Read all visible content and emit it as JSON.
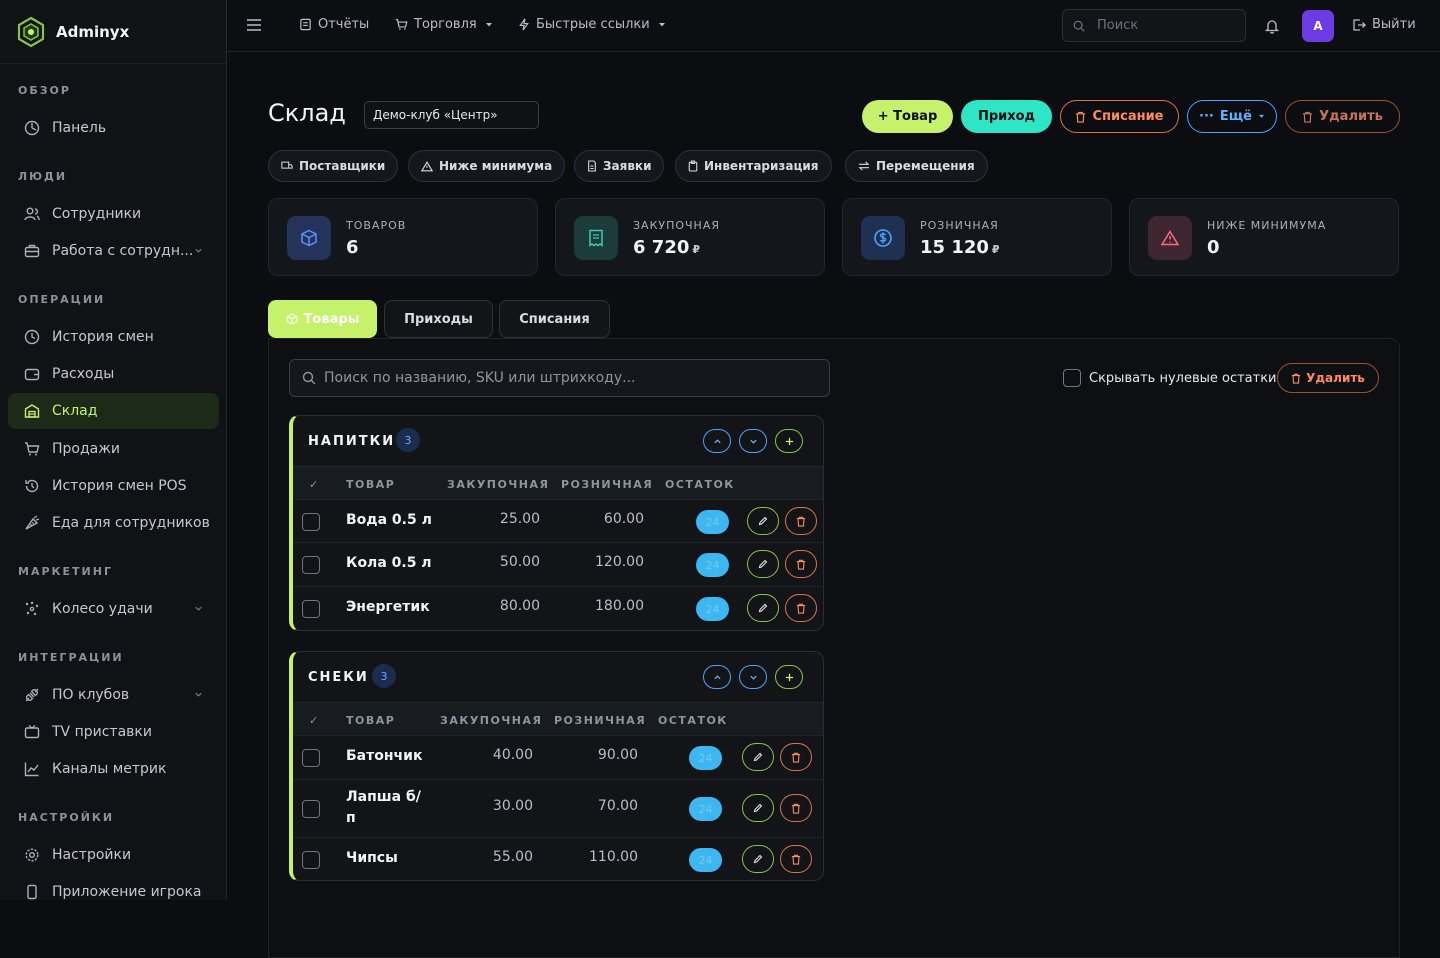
{
  "brand": {
    "name": "Adminyx"
  },
  "sidebar": {
    "sections": [
      {
        "title": "ОБЗОР",
        "items": [
          {
            "label": "Панель",
            "icon": "dashboard-icon"
          }
        ]
      },
      {
        "title": "ЛЮДИ",
        "items": [
          {
            "label": "Сотрудники",
            "icon": "users-icon"
          },
          {
            "label": "Работа с сотрудн...",
            "icon": "briefcase-icon",
            "expandable": true
          }
        ]
      },
      {
        "title": "ОПЕРАЦИИ",
        "items": [
          {
            "label": "История смен",
            "icon": "clock-icon"
          },
          {
            "label": "Расходы",
            "icon": "wallet-icon"
          },
          {
            "label": "Склад",
            "icon": "warehouse-icon",
            "active": true
          },
          {
            "label": "Продажи",
            "icon": "cart-icon"
          },
          {
            "label": "История смен POS",
            "icon": "history-icon"
          },
          {
            "label": "Еда для сотрудников",
            "icon": "food-icon"
          }
        ]
      },
      {
        "title": "МАРКЕТИНГ",
        "items": [
          {
            "label": "Колесо удачи",
            "icon": "wheel-icon",
            "expandable": true
          }
        ]
      },
      {
        "title": "ИНТЕГРАЦИИ",
        "items": [
          {
            "label": "ПО клубов",
            "icon": "plug-icon",
            "expandable": true
          },
          {
            "label": "TV приставки",
            "icon": "tv-icon"
          },
          {
            "label": "Каналы метрик",
            "icon": "chart-icon"
          }
        ]
      },
      {
        "title": "НАСТРОЙКИ",
        "items": [
          {
            "label": "Настройки",
            "icon": "gear-icon"
          },
          {
            "label": "Приложение игрока",
            "icon": "phone-icon"
          }
        ]
      }
    ]
  },
  "topbar": {
    "reports": "Отчёты",
    "trade": "Торговля",
    "quick_links": "Быстрые ссылки",
    "search_placeholder": "Поиск",
    "avatar_letter": "A",
    "logout": "Выйти"
  },
  "page": {
    "title": "Склад",
    "club": "Демо-клуб «Центр»",
    "actions": {
      "add_product": "+ Товар",
      "income": "Приход",
      "writeoff": "Списание",
      "more": "Ещё",
      "delete": "Удалить"
    },
    "chips": [
      "Поставщики",
      "Ниже минимума",
      "Заявки",
      "Инвентаризация",
      "Перемещения"
    ]
  },
  "stats": [
    {
      "label": "ТОВАРОВ",
      "value": "6",
      "currency": "",
      "color": "#5b8dff",
      "icon": "box-icon"
    },
    {
      "label": "ЗАКУПОЧНАЯ",
      "value": "6 720",
      "currency": "₽",
      "color": "#3fc9b0",
      "icon": "receipt-icon"
    },
    {
      "label": "РОЗНИЧНАЯ",
      "value": "15 120",
      "currency": "₽",
      "color": "#4aa3ff",
      "icon": "dollar-icon"
    },
    {
      "label": "НИЖЕ МИНИМУМА",
      "value": "0",
      "currency": "",
      "color": "#ff6b7a",
      "icon": "alert-icon"
    }
  ],
  "tabs": [
    "Товары",
    "Приходы",
    "Списания"
  ],
  "inventory": {
    "search_placeholder": "Поиск по названию, SKU или штрихкоду...",
    "hide_zero_label": "Скрывать нулевые остатки",
    "delete_label": "Удалить",
    "columns": [
      "✓",
      "ТОВАР",
      "ЗАКУПОЧНАЯ",
      "РОЗНИЧНАЯ",
      "ОСТАТОК"
    ],
    "groups": [
      {
        "title": "НАПИТКИ",
        "count": "3",
        "rows": [
          {
            "name": "Вода 0.5 л",
            "purchase": "25.00",
            "retail": "60.00",
            "stock": "24"
          },
          {
            "name": "Кола 0.5 л",
            "purchase": "50.00",
            "retail": "120.00",
            "stock": "24"
          },
          {
            "name": "Энергетик",
            "purchase": "80.00",
            "retail": "180.00",
            "stock": "24"
          }
        ]
      },
      {
        "title": "СНЕКИ",
        "count": "3",
        "rows": [
          {
            "name": "Батончик",
            "purchase": "40.00",
            "retail": "90.00",
            "stock": "24"
          },
          {
            "name": "Лапша б/п",
            "purchase": "30.00",
            "retail": "70.00",
            "stock": "24"
          },
          {
            "name": "Чипсы",
            "purchase": "55.00",
            "retail": "110.00",
            "stock": "24"
          }
        ]
      }
    ]
  },
  "colors": {
    "accent": "#c6f26b",
    "teal": "#2ee6c5",
    "danger": "#e0734a",
    "info": "#4aa3ff",
    "badge": "#3cb7f1"
  }
}
